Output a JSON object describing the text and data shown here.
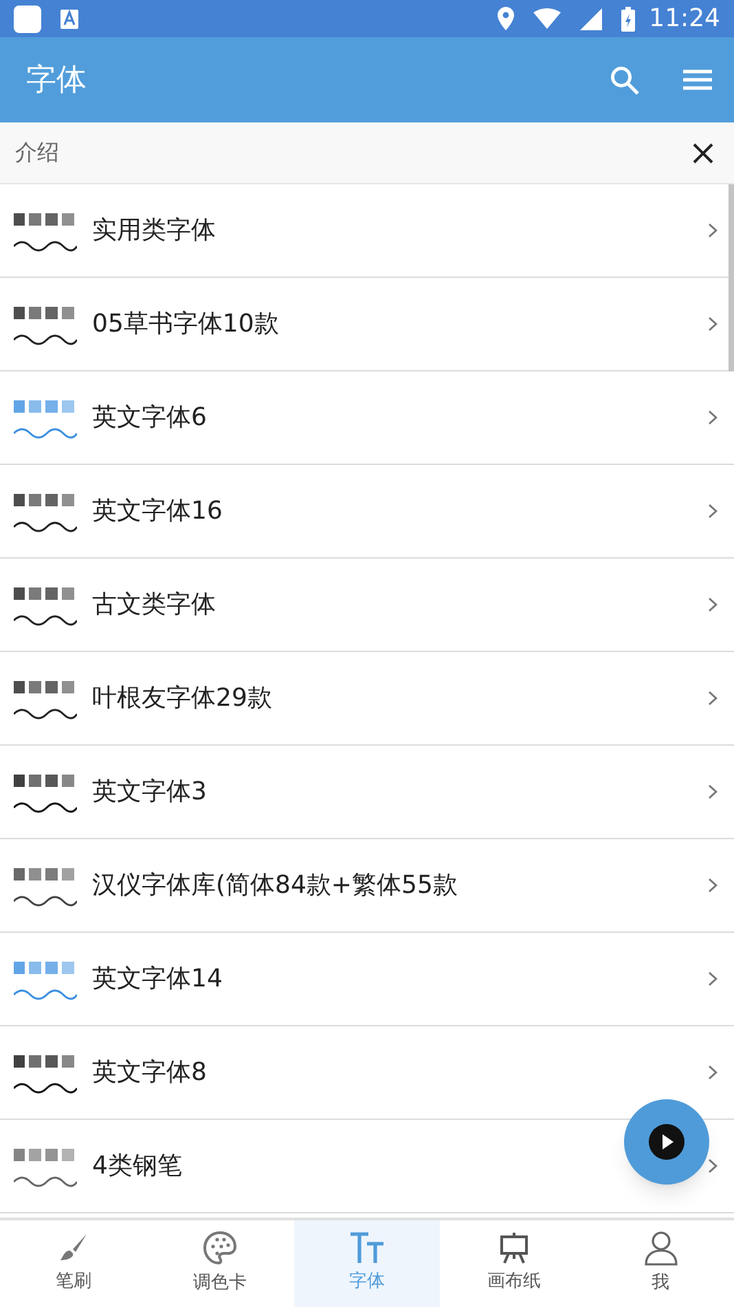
{
  "status_bar": {
    "time": "11:24"
  },
  "app_bar": {
    "title": "字体"
  },
  "search": {
    "value": "介绍"
  },
  "fonts": [
    {
      "name": "实用类字体",
      "kind": "picture"
    },
    {
      "name": "05草书字体10款",
      "kind": "picture"
    },
    {
      "name": "英文字体6",
      "kind": "picture"
    },
    {
      "name": "英文字体16",
      "kind": "picture"
    },
    {
      "name": "古文类字体",
      "kind": "picture"
    },
    {
      "name": "叶根友字体29款",
      "kind": "picture"
    },
    {
      "name": "英文字体3",
      "kind": "picture"
    },
    {
      "name": "汉仪字体库(简体84款+繁体55款",
      "kind": "picture"
    },
    {
      "name": "英文字体14",
      "kind": "picture"
    },
    {
      "name": "英文字体8",
      "kind": "picture"
    },
    {
      "name": "4类钢笔",
      "kind": "picture"
    }
  ],
  "tabs": [
    {
      "label": "笔刷",
      "kind": "brush",
      "selected": false
    },
    {
      "label": "调色卡",
      "kind": "palette",
      "selected": false
    },
    {
      "label": "字体",
      "kind": "font",
      "selected": true
    },
    {
      "label": "画布纸",
      "kind": "easel",
      "selected": false
    },
    {
      "label": "我",
      "kind": "person",
      "selected": false
    }
  ]
}
